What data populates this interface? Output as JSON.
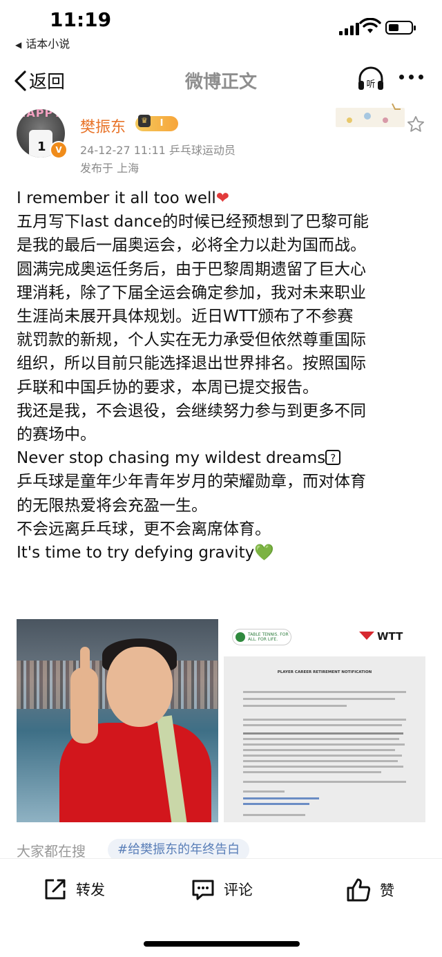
{
  "status_bar": {
    "time": "11:19",
    "back_app": "话本小说"
  },
  "nav": {
    "back_label": "返回",
    "title": "微博正文"
  },
  "post": {
    "author": "樊振东",
    "level": "I",
    "avatar_text": "HAPPY",
    "avatar_number": "1",
    "meta": "24-12-27 11:11  乒乓球运动员",
    "location": "发布于 上海",
    "lines": [
      "I remember it all too well",
      "五月写下last dance的时候已经预想到了巴黎可能",
      "是我的最后一届奥运会，必将全力以赴为国而战。",
      "圆满完成奥运任务后，由于巴黎周期遗留了巨大心",
      "理消耗，除了下届全运会确定参加，我对未来职业",
      "生涯尚未展开具体规划。近日WTT颁布了不参赛",
      "就罚款的新规，个人实在无力承受但依然尊重国际",
      "组织，所以目前只能选择退出世界排名。按照国际",
      "乒联和中国乒协的要求，本周已提交报告。",
      "我还是我，不会退役，会继续努力参与到更多不同",
      "的赛场中。",
      "Never stop chasing my wildest dreams",
      "乒乓球是童年少年青年岁月的荣耀勋章，而对体育",
      "的无限热爱将会充盈一生。",
      "不会远离乒乓球，更不会离席体育。",
      "It's time to try defying gravity"
    ],
    "emoji": {
      "heart": "❤",
      "unknown": "?",
      "green_heart": "💚"
    }
  },
  "images": {
    "doc": {
      "ittf_label": "TABLE TENNIS. FOR ALL. FOR LIFE.",
      "wtt_label": "WTT",
      "title": "PLAYER CAREER RETIREMENT NOTIFICATION"
    }
  },
  "tags": {
    "label": "大家都在搜",
    "topic": "#给樊振东的年终告白"
  },
  "actions": {
    "repost": "转发",
    "comment": "评论",
    "like": "赞"
  }
}
